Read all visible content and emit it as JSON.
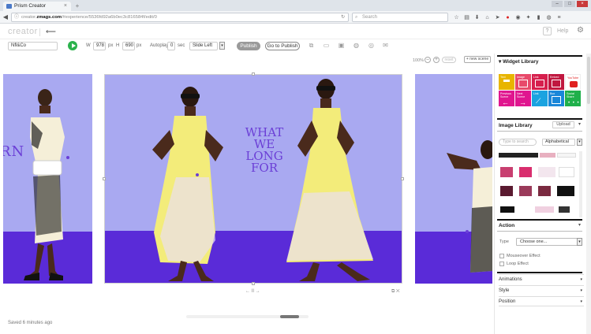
{
  "browser": {
    "tab_title": "Prism Creator",
    "tab_close": "×",
    "new_tab": "+",
    "url_domain": "creator.zmags.com",
    "url_path": "/#experience/5536fd92a6b0ec3c816584f/edit/0",
    "url_prefix": "creator.",
    "url_domain_bold": "zmags.com",
    "search_placeholder": "Search",
    "win_min": "–",
    "win_max": "□",
    "win_close": "×"
  },
  "app": {
    "logo": "creator",
    "help_label": "Help",
    "help_icon_text": "?"
  },
  "toolbar": {
    "project_name": "Nfl&Co",
    "width_label": "W",
    "width_value": "978",
    "width_unit": "px",
    "height_label": "H",
    "height_value": "690",
    "height_unit": "px",
    "autoplay_label": "Autoplay",
    "autoplay_value": "0",
    "autoplay_unit": "sec",
    "transition_value": "Slide Left",
    "publish_label": "Publish",
    "go_publish_label": "Go to Publish"
  },
  "zoom": {
    "level": "100%",
    "minus": "–",
    "plus": "+",
    "reset": "reset",
    "new_scene": "+ new scene"
  },
  "canvas": {
    "headline_lines": [
      "WHAT",
      "WE",
      "LONG",
      "FOR"
    ],
    "partial_text": "RN",
    "slide_nav": "← II →",
    "slide_icons": "⧉  ✕",
    "saved_status": "Saved 6 minutes ago",
    "colors": {
      "background": "#a9a9f1",
      "floor": "#5a2bd8",
      "dress": "#f3ec7a"
    }
  },
  "panel": {
    "widget_library_title": "Widget Library",
    "widgets": [
      {
        "label": "Text",
        "color": "#e8b500"
      },
      {
        "label": "Image",
        "color": "#e8496a"
      },
      {
        "label": "Link",
        "color": "#d61f4d"
      },
      {
        "label": "Embed",
        "color": "#c0173f"
      },
      {
        "label": "YouTube",
        "color": "#ffffff"
      },
      {
        "label": "Previous Scene",
        "color": "#e0168f"
      },
      {
        "label": "Next Scene",
        "color": "#e0168f"
      },
      {
        "label": "Link",
        "color": "#1aa3e0"
      },
      {
        "label": "Box",
        "color": "#1a87d9"
      },
      {
        "label": "Social Share",
        "color": "#1fb04a"
      }
    ],
    "image_library_title": "Image Library",
    "upload_label": "Upload",
    "image_search_placeholder": "Type to search",
    "sort_value": "Alphabetical",
    "action_title": "Action",
    "type_label": "Type",
    "type_value": "Choose one...",
    "mouseover_label": "Mouseover Effect",
    "loop_label": "Loop Effect",
    "animations_label": "Animations",
    "style_label": "Style",
    "position_label": "Position"
  }
}
